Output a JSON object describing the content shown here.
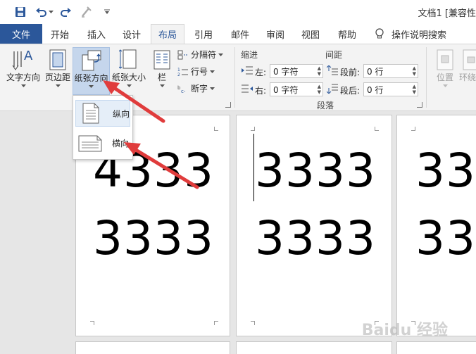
{
  "title_bar": {
    "doc_title": "文档1 [兼容性"
  },
  "tabs": {
    "file": "文件",
    "items": [
      "开始",
      "插入",
      "设计",
      "布局",
      "引用",
      "邮件",
      "审阅",
      "视图",
      "帮助"
    ],
    "active": "布局",
    "tell_me": "操作说明搜索"
  },
  "ribbon": {
    "text_direction": "文字方向",
    "margins": "页边距",
    "orientation": "纸张方向",
    "size": "纸张大小",
    "columns": "栏",
    "breaks": "分隔符",
    "line_numbers": "行号",
    "hyphenation": "断字",
    "indent": {
      "title": "缩进",
      "left_label": "左:",
      "left_value": "0 字符",
      "right_label": "右:",
      "right_value": "0 字符"
    },
    "spacing": {
      "title": "间距",
      "before_label": "段前:",
      "before_value": "0 行",
      "after_label": "段后:",
      "after_value": "0 行"
    },
    "paragraph_group": "段落",
    "position": "位置",
    "wrap_text": "环绕"
  },
  "orientation_menu": {
    "portrait": "纵向",
    "landscape": "横向"
  },
  "document": {
    "page1_line1": "4333",
    "page1_line2": "3333",
    "page2_line1": "3333",
    "page2_line2": "3333",
    "page3_line1": "333",
    "page3_line2": "333"
  },
  "watermark": "Baidu 经验",
  "colors": {
    "accent": "#2b579a",
    "annotation_arrow": "#e03c3c"
  }
}
